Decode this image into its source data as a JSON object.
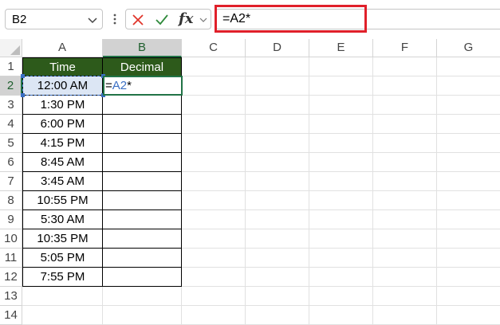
{
  "formula_bar": {
    "name_box": "B2",
    "fx_label": "fx",
    "formula": "=A2*"
  },
  "columns": [
    "A",
    "B",
    "C",
    "D",
    "E",
    "F",
    "G"
  ],
  "rows": [
    "1",
    "2",
    "3",
    "4",
    "5",
    "6",
    "7",
    "8",
    "9",
    "10",
    "11",
    "12",
    "13",
    "14"
  ],
  "table": {
    "headers": [
      "Time",
      "Decimal"
    ],
    "times": [
      "12:00 AM",
      "1:30 PM",
      "6:00 PM",
      "4:15 PM",
      "8:45 AM",
      "3:45 AM",
      "10:55 PM",
      "5:30 AM",
      "10:35 PM",
      "5:05 PM",
      "7:55 PM"
    ]
  },
  "active_cell": {
    "ref": "B2",
    "edit_prefix": "=",
    "edit_ref": "A2",
    "edit_suffix": "*"
  },
  "colors": {
    "header_fill": "#2d5a1b",
    "highlight": "#e0202a",
    "selection": "#217346",
    "reference": "#3a6fc4"
  }
}
